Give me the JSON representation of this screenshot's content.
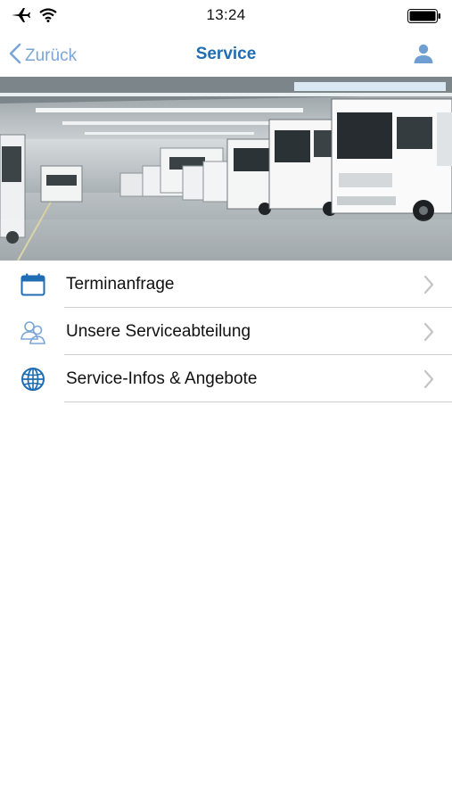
{
  "status_bar": {
    "time": "13:24",
    "icons": [
      "airplane-icon",
      "wifi-icon",
      "battery-icon"
    ]
  },
  "nav": {
    "back_label": "Zurück",
    "title": "Service",
    "profile_icon": "person-icon"
  },
  "hero": {
    "description_icon": "photo-motorhomes-workshop"
  },
  "menu": {
    "items": [
      {
        "label": "Terminanfrage",
        "icon": "calendar-icon"
      },
      {
        "label": "Unsere Serviceabteilung",
        "icon": "team-icon"
      },
      {
        "label": "Service-Infos & Angebote",
        "icon": "globe-icon"
      }
    ]
  },
  "colors": {
    "accent": "#1f6db3",
    "back_link": "#7aa6d6",
    "separator": "#cfcfcf",
    "chevron": "#c4c4c4"
  }
}
